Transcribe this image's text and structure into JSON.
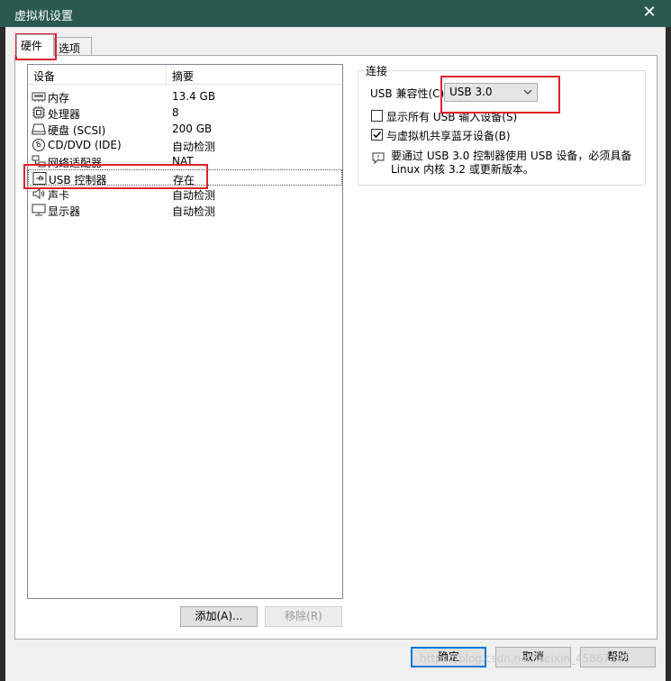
{
  "window": {
    "title": "虚拟机设置",
    "close_glyph": "✕"
  },
  "tabs": [
    {
      "label": "硬件",
      "active": true
    },
    {
      "label": "选项",
      "active": false
    }
  ],
  "device_list": {
    "headers": {
      "device": "设备",
      "summary": "摘要"
    },
    "rows": [
      {
        "icon": "memory-icon",
        "name": "内存",
        "summary": "13.4 GB"
      },
      {
        "icon": "processor-icon",
        "name": "处理器",
        "summary": "8"
      },
      {
        "icon": "hard-disk-icon",
        "name": "硬盘 (SCSI)",
        "summary": "200 GB"
      },
      {
        "icon": "cd-dvd-icon",
        "name": "CD/DVD (IDE)",
        "summary": "自动检测"
      },
      {
        "icon": "network-adapter-icon",
        "name": "网络适配器",
        "summary": "NAT"
      },
      {
        "icon": "usb-icon",
        "name": "USB 控制器",
        "summary": "存在",
        "selected": true
      },
      {
        "icon": "speaker-icon",
        "name": "声卡",
        "summary": "自动检测"
      },
      {
        "icon": "monitor-icon",
        "name": "显示器",
        "summary": "自动检测"
      }
    ]
  },
  "list_buttons": {
    "add": "添加(A)...",
    "remove": "移除(R)"
  },
  "connection": {
    "group_label": "连接",
    "usb_compat_label": "USB 兼容性(C):",
    "usb_compat_value": "USB 3.0",
    "show_all_label": "显示所有 USB 输入设备(S)",
    "show_all_checked": false,
    "share_bt_label": "与虚拟机共享蓝牙设备(B)",
    "share_bt_checked": true,
    "info_text": "要通过 USB 3.0 控制器使用 USB 设备，必须具备 Linux 内核 3.2 或更新版本。"
  },
  "footer": {
    "ok": "确定",
    "cancel": "取消",
    "help": "帮助"
  },
  "watermark": "https://blog.csdn.net/weixin_45867195",
  "colors": {
    "titlebar": "#2a5a4e",
    "highlight": "#e0202a",
    "primary_border": "#0078d7"
  }
}
